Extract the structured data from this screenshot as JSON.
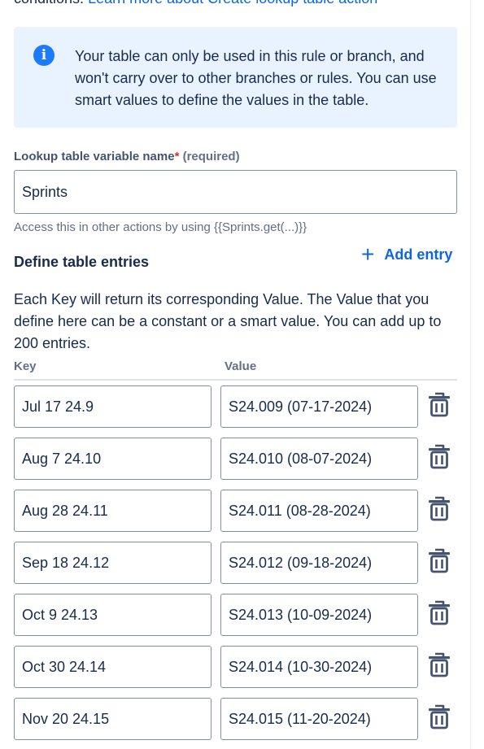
{
  "top_cut": {
    "text": "conditions.",
    "link": "Learn more about Create lookup table action"
  },
  "info_panel": {
    "icon": "info-icon",
    "icon_glyph": "i",
    "text": "Your table can only be used in this rule or branch, and won't carry over to other branches or rules. You can use smart values to define the values in the table."
  },
  "variable_field": {
    "label": "Lookup table variable name",
    "required_marker": "*",
    "required_text": "(required)",
    "value": "Sprints",
    "helper": "Access this in other actions by using {{Sprints.get(...)}}"
  },
  "entries_section": {
    "title": "Define table entries",
    "add_entry_label": "Add entry",
    "add_entry_icon": "plus-icon",
    "description": "Each Key will return its corresponding Value. The Value that you define here can be a constant or a smart value. You can add up to 200 entries.",
    "key_header": "Key",
    "value_header": "Value",
    "delete_icon": "trash-icon",
    "rows": [
      {
        "key": "Jul 17 24.9",
        "value": "S24.009 (07-17-2024)"
      },
      {
        "key": "Aug 7 24.10",
        "value": "S24.010 (08-07-2024)"
      },
      {
        "key": "Aug 28 24.11",
        "value": "S24.011 (08-28-2024)"
      },
      {
        "key": "Sep 18 24.12",
        "value": "S24.012 (09-18-2024)"
      },
      {
        "key": "Oct 9 24.13",
        "value": "S24.013 (10-09-2024)"
      },
      {
        "key": "Oct 30 24.14",
        "value": "S24.014 (10-30-2024)"
      },
      {
        "key": "Nov 20 24.15",
        "value": "S24.015 (11-20-2024)"
      }
    ]
  },
  "colors": {
    "link": "#0c66e4",
    "info_bg": "#e9f2ff",
    "info_icon": "#1d7afc",
    "required": "#c9372c",
    "border": "#8590a2",
    "icon": "#44546f"
  }
}
